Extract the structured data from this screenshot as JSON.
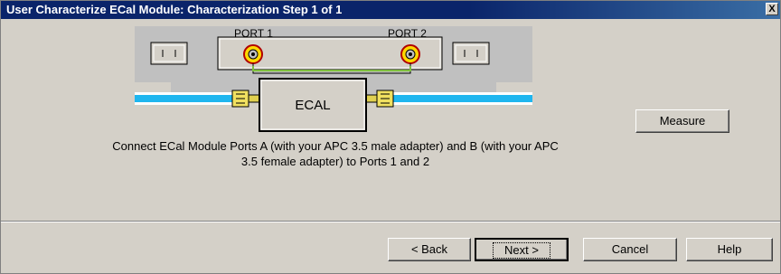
{
  "window": {
    "title": "User Characterize ECal Module: Characterization Step 1 of 1",
    "close_glyph": "X"
  },
  "diagram": {
    "port1_label": "PORT 1",
    "port2_label": "PORT 2",
    "module_label": "ECAL"
  },
  "instructions": {
    "line1": "Connect ECal Module Ports A (with your APC 3.5 male adapter) and B (with your APC",
    "line2": "3.5 female adapter) to Ports 1 and 2"
  },
  "buttons": {
    "measure": "Measure",
    "back": "< Back",
    "next": "Next >",
    "cancel": "Cancel",
    "help": "Help"
  }
}
